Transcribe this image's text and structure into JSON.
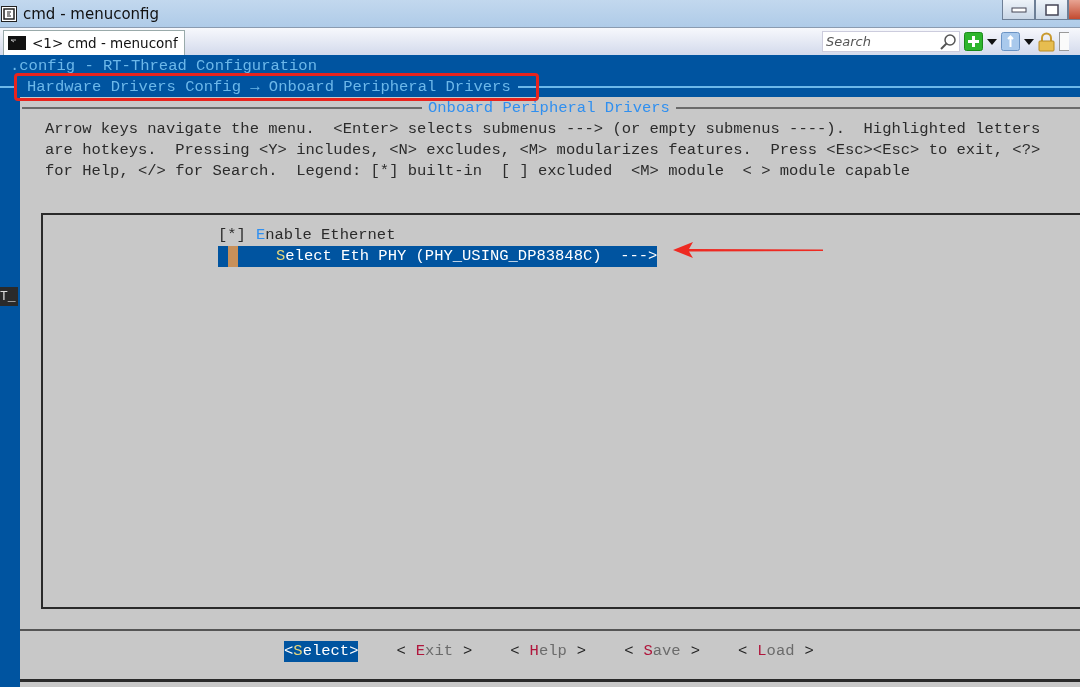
{
  "window": {
    "title": "cmd - menuconfig"
  },
  "tabs": [
    {
      "label": "<1> cmd - menuconf",
      "selected": true
    }
  ],
  "search": {
    "placeholder": "Search"
  },
  "terminal": {
    "config_line": ".config - RT-Thread Configuration",
    "breadcrumb": "Hardware Drivers Config → Onboard Peripheral Drivers",
    "side_fragment": "T_"
  },
  "dialog": {
    "title": "Onboard Peripheral Drivers",
    "help_lines": [
      "Arrow keys navigate the menu.  <Enter> selects submenus ---> (or empty submenus ----).  Highlighted letters",
      "are hotkeys.  Pressing <Y> includes, <N> excludes, <M> modularizes features.  Press <Esc><Esc> to exit, <?>",
      "for Help, </> for Search.  Legend: [*] built-in  [ ] excluded  <M> module  < > module capable"
    ],
    "items": [
      {
        "kind": "bool",
        "checkbox": "[*]",
        "checked": true,
        "hotkey": "E",
        "rest": "nable Ethernet",
        "selected": false
      },
      {
        "kind": "submenu",
        "hotkey": "S",
        "rest": "elect Eth PHY (PHY_USING_DP83848C)  --->",
        "selected": true
      }
    ],
    "buttons": [
      {
        "open": "<",
        "hotkey": "S",
        "rest": "elect",
        "close": ">",
        "selected": true
      },
      {
        "open": "<",
        "hotkey": "E",
        "rest": "xit",
        "close": ">",
        "selected": false
      },
      {
        "open": "<",
        "hotkey": "H",
        "rest": "elp",
        "close": ">",
        "selected": false
      },
      {
        "open": "<",
        "hotkey": "S",
        "rest": "ave",
        "close": ">",
        "selected": false
      },
      {
        "open": "<",
        "hotkey": "L",
        "rest": "oad",
        "close": ">",
        "selected": false
      }
    ]
  }
}
